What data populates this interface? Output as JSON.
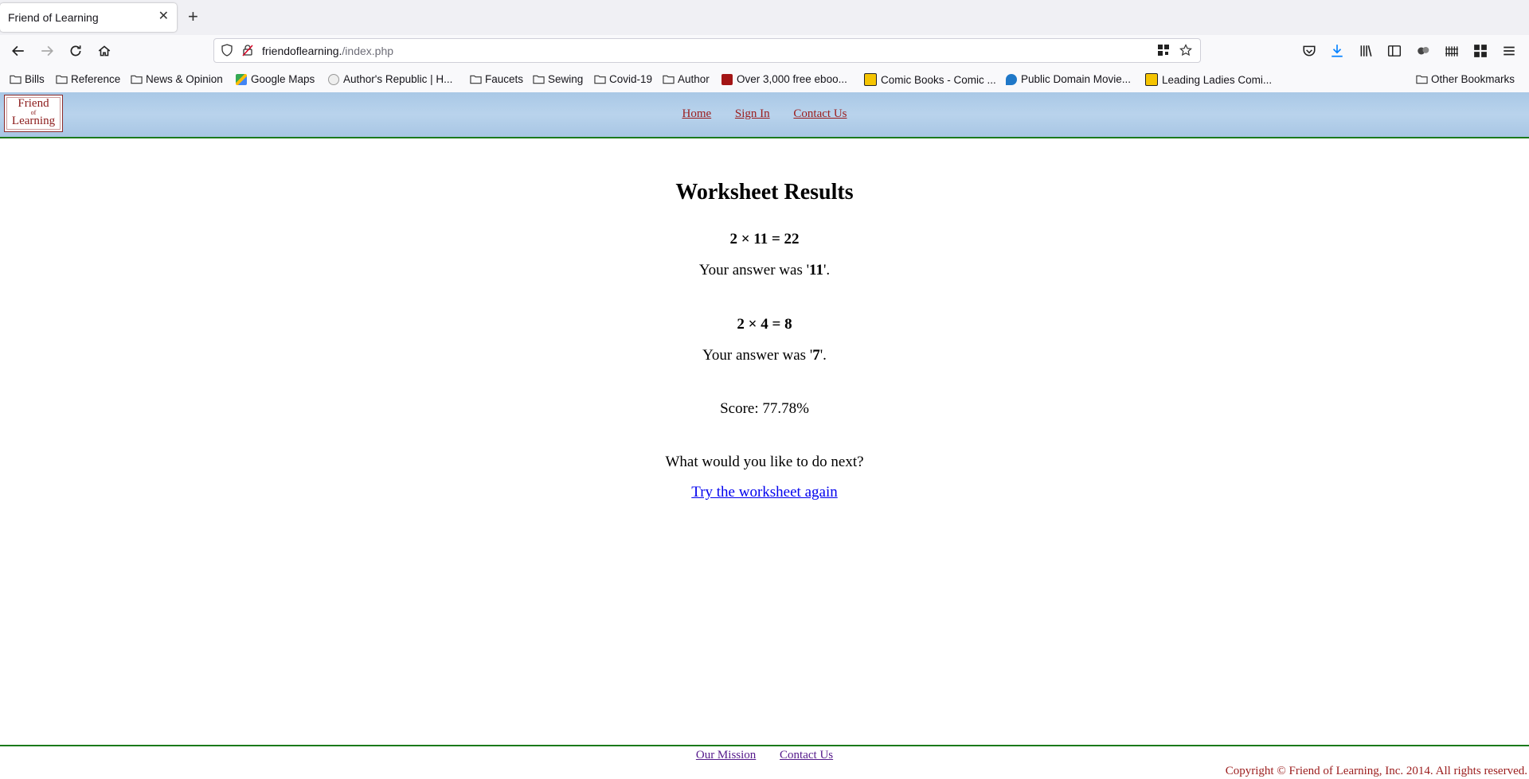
{
  "browser": {
    "tab_title": "Friend of Learning",
    "tab_close_icon": "close-icon",
    "new_tab_icon": "plus-icon",
    "url_host": "friendoflearning.",
    "url_path": "/index.php",
    "bookmarks": [
      {
        "label": "Bills",
        "icon": "folder-icon"
      },
      {
        "label": "Reference",
        "icon": "folder-icon"
      },
      {
        "label": "News & Opinion",
        "icon": "folder-icon"
      },
      {
        "label": "Google Maps",
        "icon": "maps-icon"
      },
      {
        "label": "Author's Republic | H...",
        "icon": "site-icon"
      },
      {
        "label": "Faucets",
        "icon": "folder-icon"
      },
      {
        "label": "Sewing",
        "icon": "folder-icon"
      },
      {
        "label": "Covid-19",
        "icon": "folder-icon"
      },
      {
        "label": "Author",
        "icon": "folder-icon"
      },
      {
        "label": "Over 3,000 free eboo...",
        "icon": "book-icon"
      },
      {
        "label": "Comic Books - Comic ...",
        "icon": "comic-icon"
      },
      {
        "label": "Public Domain Movie...",
        "icon": "drupal-icon"
      },
      {
        "label": "Leading Ladies Comi...",
        "icon": "comic-icon"
      }
    ],
    "other_bookmarks": "Other Bookmarks"
  },
  "site": {
    "logo": {
      "line1": "Friend",
      "line2": "of",
      "line3": "Learning"
    },
    "nav": {
      "home": "Home",
      "sign_in": "Sign In",
      "contact": "Contact Us"
    },
    "link_color": "#9b1c1c",
    "rule_color": "#1b7a1b"
  },
  "results": {
    "title": "Worksheet Results",
    "problems": [
      {
        "equation": "2 × 11 = 22",
        "answer_prefix": "Your answer was '",
        "answer": "11",
        "answer_suffix": "'."
      },
      {
        "equation": "2 × 4 = 8",
        "answer_prefix": "Your answer was '",
        "answer": "7",
        "answer_suffix": "'."
      }
    ],
    "score": "Score: 77.78%",
    "next_prompt": "What would you like to do next?",
    "try_again": "Try the worksheet again"
  },
  "footer": {
    "mission": "Our Mission",
    "contact": "Contact Us",
    "copyright": "Copyright © Friend of Learning, Inc. 2014. All rights reserved."
  }
}
